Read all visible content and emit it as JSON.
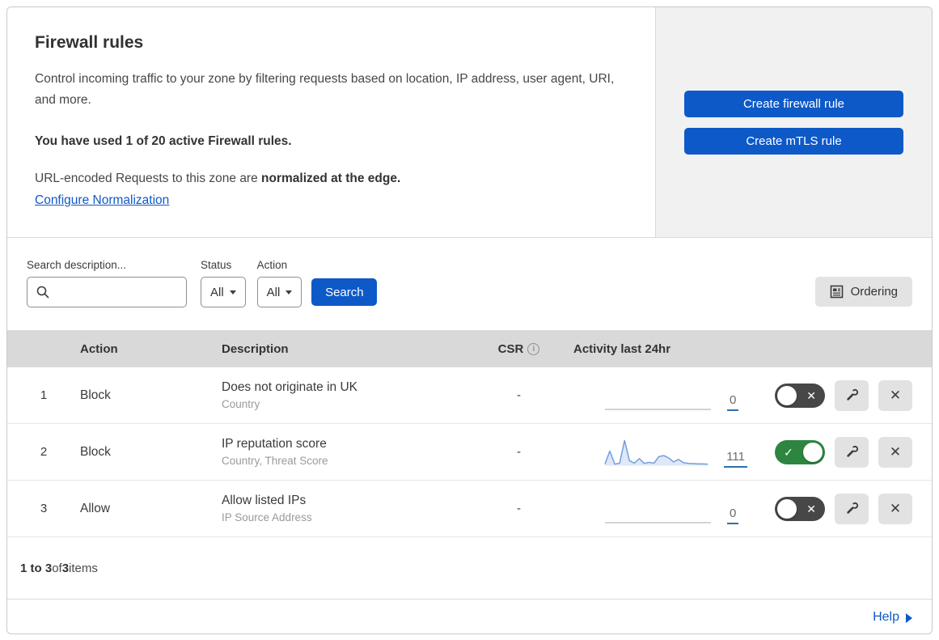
{
  "header": {
    "title": "Firewall rules",
    "description": "Control incoming traffic to your zone by filtering requests based on location, IP address, user agent, URI, and more.",
    "usage": "You have used 1 of 20 active Firewall rules.",
    "normalization_prefix": "URL-encoded Requests to this zone are ",
    "normalization_bold": "normalized at the edge.",
    "normalization_link": "Configure Normalization",
    "buttons": [
      {
        "label": "Create firewall rule"
      },
      {
        "label": "Create mTLS rule"
      }
    ]
  },
  "filters": {
    "search_label": "Search description...",
    "search_value": "",
    "status_label": "Status",
    "status_value": "All",
    "action_label": "Action",
    "action_value": "All",
    "search_button": "Search",
    "ordering_button": "Ordering"
  },
  "table": {
    "columns": {
      "action": "Action",
      "description": "Description",
      "csr": "CSR",
      "activity": "Activity last 24hr"
    },
    "rows": [
      {
        "index": "1",
        "action": "Block",
        "description": "Does not originate in UK",
        "fields": "Country",
        "csr": "-",
        "activity_count": "0",
        "enabled": false,
        "sparkline": null
      },
      {
        "index": "2",
        "action": "Block",
        "description": "IP reputation score",
        "fields": "Country, Threat Score",
        "csr": "-",
        "activity_count": "111",
        "enabled": true,
        "sparkline": [
          6,
          58,
          6,
          10,
          100,
          20,
          10,
          28,
          9,
          13,
          10,
          36,
          40,
          31,
          15,
          25,
          12,
          9,
          8,
          7,
          7,
          6
        ]
      },
      {
        "index": "3",
        "action": "Allow",
        "description": "Allow listed IPs",
        "fields": "IP Source Address",
        "csr": "-",
        "activity_count": "0",
        "enabled": false,
        "sparkline": null
      }
    ]
  },
  "footer": {
    "range_bold": "1 to 3",
    "of_text": " of ",
    "total_bold": "3",
    "items_text": " items",
    "help_label": "Help"
  },
  "icons": {
    "search": "magnifier-glass",
    "ordering": "list-document",
    "csr_info": "circled-i",
    "toggle_on": "checkmark",
    "toggle_off": "cross",
    "edit": "wrench",
    "delete": "x-cross",
    "help_arrow": "right-triangle",
    "select_caret": "down-triangle"
  },
  "colors": {
    "primary_blue": "#0e59c8",
    "link_blue": "#0e59c8",
    "toggle_on_green": "#2e8540",
    "toggle_off_gray": "#474747",
    "sparkline_blue": "#6f9be0",
    "sparkline_fill": "#dfe8f8",
    "table_header_gray": "#d9d9d9",
    "panel_gray": "#f1f1f1",
    "count_underline_blue": "#2f6fae"
  }
}
